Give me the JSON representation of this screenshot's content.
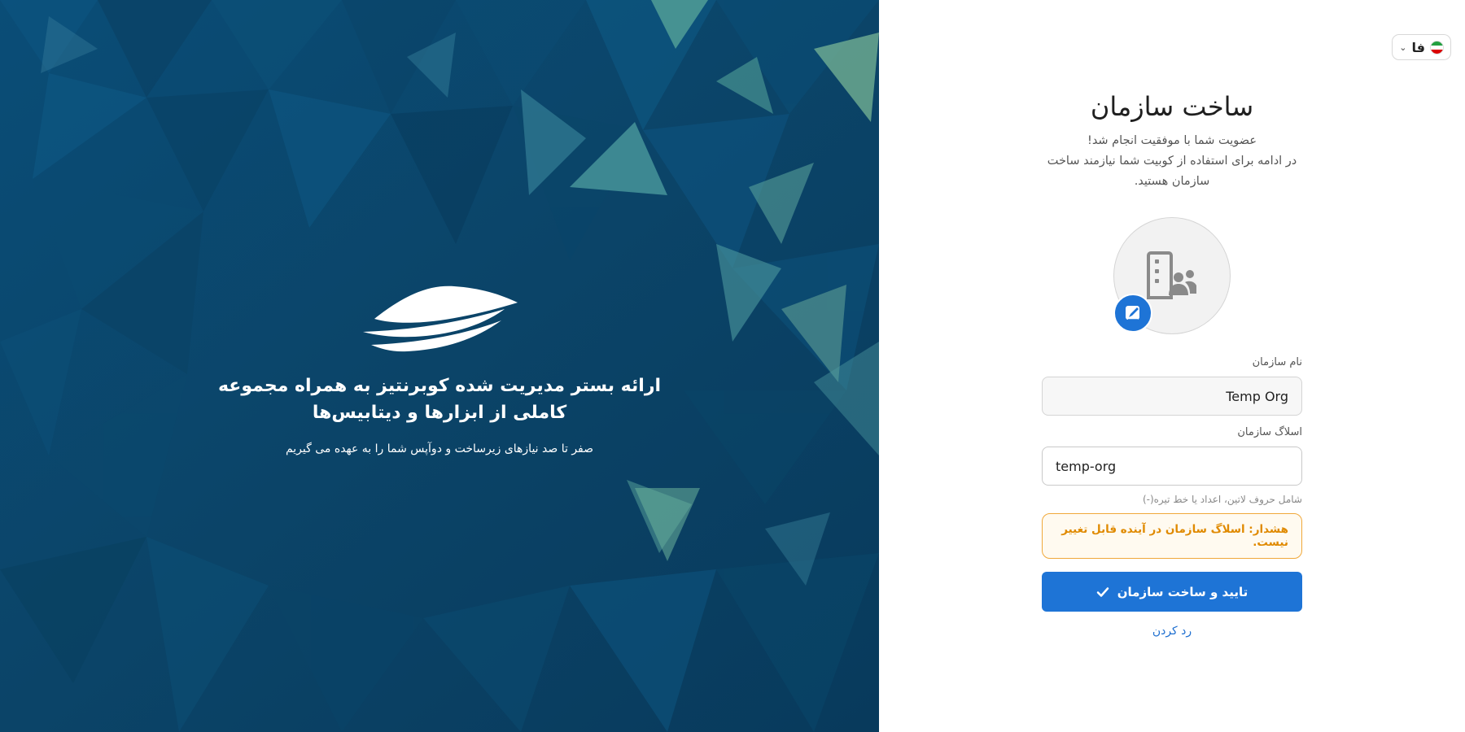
{
  "hero": {
    "title": "ارائه بستر مدیریت شده کوبرنتیز به همراه مجموعه کاملی از ابزارها و دیتابیس‌ها",
    "subtitle": "صفر تا صد نیازهای زیرساخت و دوآپس شما را به عهده می گیریم",
    "logo_icon": "ship-logo-icon"
  },
  "language": {
    "label": "فا",
    "flag_icon": "iran-flag-icon",
    "chevron_icon": "chevron-down-icon"
  },
  "form": {
    "title": "ساخت سازمان",
    "description_line1": "عضویت شما با موفقیت انجام شد!",
    "description_line2": "در ادامه برای استفاده از کوبیت شما نیازمند ساخت سازمان هستید.",
    "avatar_icon": "organization-users-icon",
    "avatar_edit_icon": "edit-image-icon",
    "name_label": "نام سازمان",
    "name_value": "Temp Org",
    "slug_label": "اسلاگ سازمان",
    "slug_value": "temp-org",
    "slug_hint": "شامل حروف لاتین، اعداد یا خط تیره(-)",
    "warning": "هشدار: اسلاگ سازمان در آینده قابل تغییر نیست.",
    "submit_label": "تایید و ساخت سازمان",
    "submit_icon": "check-icon",
    "cancel_label": "رد کردن"
  },
  "colors": {
    "primary": "#1e74d6",
    "hero_bg": "#0b4a72",
    "warning": "#e08a00"
  }
}
